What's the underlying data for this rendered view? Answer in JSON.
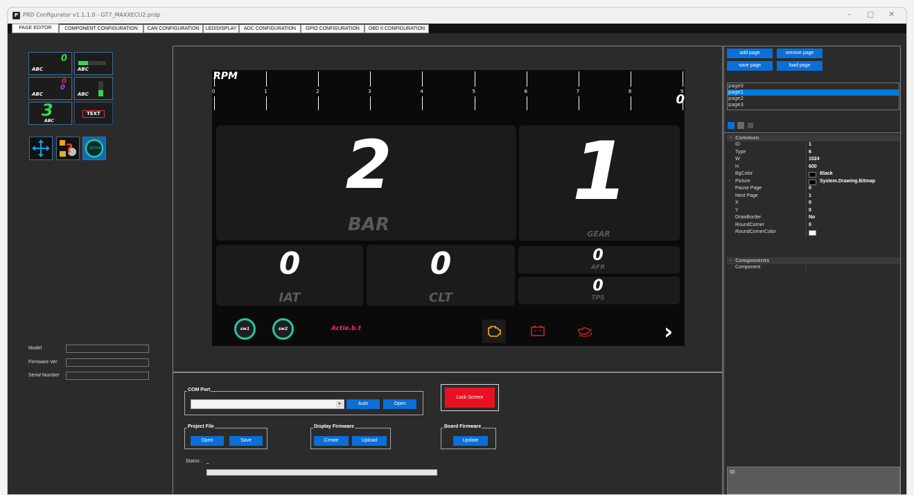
{
  "window": {
    "title": "PRD Configurator v1.1.1.0 - GT7_MAXXECU2.prdp",
    "controls": [
      "–",
      "▢",
      "✕"
    ]
  },
  "tabs": [
    "PAGE EDITOR",
    "COMPONENT CONFIGURATION",
    "CAN CONFIGURATION",
    "LED/DISPLAY",
    "ADC CONFIGURATION",
    "GPIO CONFIGURATION",
    "OBD II CONFIGURATION"
  ],
  "toolbox": {
    "abc": "ABC",
    "zero": "0",
    "three": "3",
    "text": "TEXT",
    "button_text": "BUTTON"
  },
  "device": {
    "model_label": "Model",
    "firmware_label": "Firmware Ver",
    "serial_label": "Serial Number"
  },
  "dash": {
    "rpm_label": "RPM",
    "rpm_ticks": [
      "0",
      "1",
      "2",
      "3",
      "4",
      "5",
      "6",
      "7",
      "8",
      "9"
    ],
    "rpm_value": "0",
    "boost_value": "2",
    "boost_unit": "BAR",
    "gear_value": "1",
    "gear_unit": "GEAR",
    "iat_value": "0",
    "iat_unit": "IAT",
    "clt_value": "0",
    "clt_unit": "CLT",
    "afr_value": "0",
    "afr_unit": "AFR",
    "tps_value": "0",
    "tps_unit": "TPS",
    "sw1": "sw1",
    "sw2": "sw2",
    "brand": "Actie.b.t",
    "next": "›"
  },
  "com": {
    "group": "COM Port",
    "auto": "Auto",
    "open": "Open",
    "lock": "Lock Screen"
  },
  "project": {
    "group": "Project File",
    "open": "Open",
    "save": "Save"
  },
  "display_fw": {
    "group": "Display Firmware",
    "create": "Create",
    "upload": "Upload"
  },
  "board_fw": {
    "group": "Board Firmware",
    "update": "Update"
  },
  "status": {
    "label": "Status :",
    "value": "_"
  },
  "pages": {
    "add": "add page",
    "remove": "remove page",
    "save": "save page",
    "load": "load page",
    "list": [
      "page0",
      "page1",
      "page2",
      "page3"
    ],
    "selected": 1
  },
  "props": {
    "cat_common": "Common",
    "rows": [
      {
        "k": "ID",
        "v": "1"
      },
      {
        "k": "Type",
        "v": "6"
      },
      {
        "k": "W",
        "v": "1024"
      },
      {
        "k": "H",
        "v": "600"
      },
      {
        "k": "BgColor",
        "v": "Black"
      },
      {
        "k": "Picture",
        "v": "System.Drawing.Bitmap"
      },
      {
        "k": "Pause Page",
        "v": "0"
      },
      {
        "k": "Next Page",
        "v": "1"
      },
      {
        "k": "X",
        "v": "0"
      },
      {
        "k": "Y",
        "v": "0"
      },
      {
        "k": "DrawBorder",
        "v": "No"
      },
      {
        "k": "RoundCorner",
        "v": "0"
      },
      {
        "k": "RoundCornerColor",
        "v": ""
      }
    ],
    "cat_components": "Components",
    "component_label": "Component",
    "desc": "ID"
  },
  "colors": {
    "accent": "#0a6fd6",
    "selected": "#0078d7",
    "lock": "#e81123",
    "brand": "#ff1f6a",
    "warn_amber": "#ffb300",
    "warn_red": "#e02020",
    "teal": "#26c6a0"
  }
}
